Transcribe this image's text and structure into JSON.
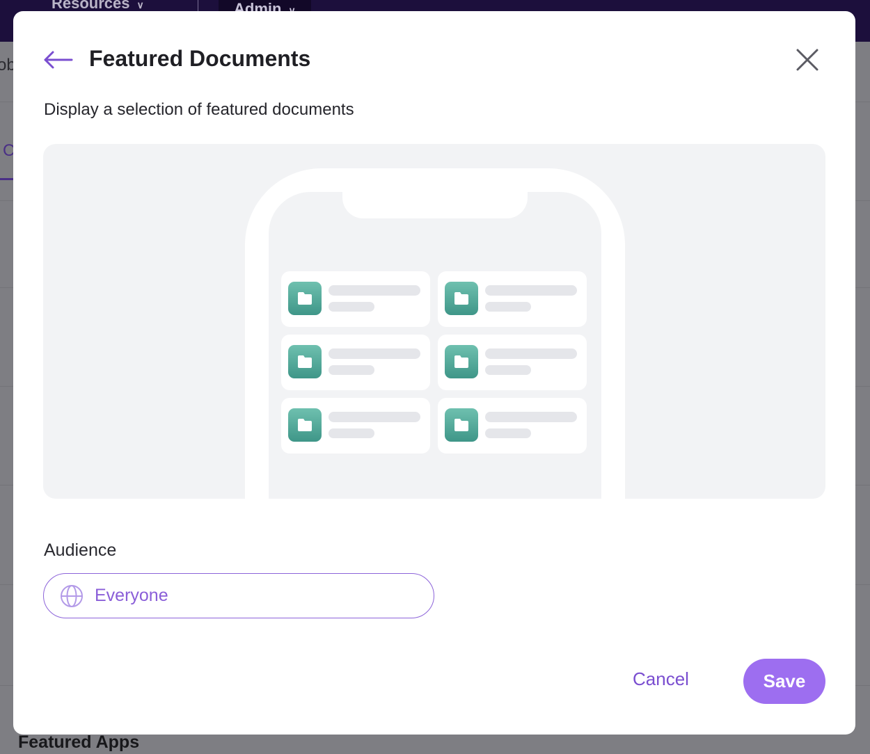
{
  "background": {
    "nav": {
      "resources": "Resources",
      "admin": "Admin"
    },
    "partial_text_left": "ob",
    "partial_tab": "C",
    "section_title": "Featured Apps"
  },
  "modal": {
    "title": "Featured Documents",
    "description": "Display a selection of featured documents",
    "audience": {
      "label": "Audience",
      "value": "Everyone",
      "icon": "globe-icon"
    },
    "buttons": {
      "cancel": "Cancel",
      "save": "Save"
    },
    "preview": {
      "card_count": 6,
      "card_icon": "folder-icon"
    }
  },
  "colors": {
    "accent": "#9d6ef0",
    "accent_text": "#7a4ed0",
    "folder_green": "#4fa899",
    "preview_bg": "#f2f3f5"
  }
}
